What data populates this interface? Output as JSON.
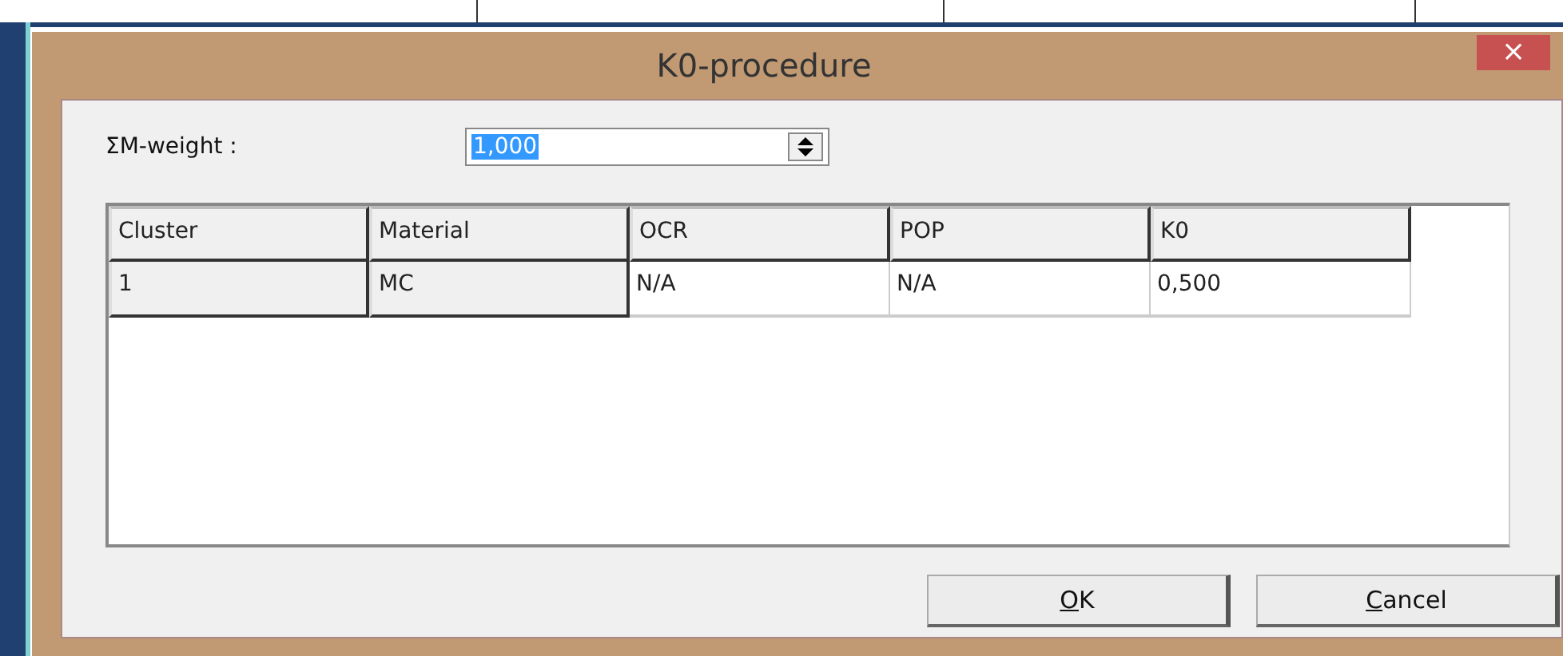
{
  "window": {
    "title": "K0-procedure",
    "close": "×"
  },
  "weight": {
    "label": "ΣM-weight :",
    "value": "1,000",
    "text_selected": true
  },
  "table": {
    "columns": [
      {
        "label": "Cluster",
        "fixed": true
      },
      {
        "label": "Material",
        "fixed": true
      },
      {
        "label": "OCR",
        "fixed": false
      },
      {
        "label": "POP",
        "fixed": false
      },
      {
        "label": "K0",
        "fixed": false
      }
    ],
    "rows": [
      [
        "1",
        "MC",
        "N/A",
        "N/A",
        "0,500"
      ]
    ]
  },
  "buttons": [
    {
      "label": "OK",
      "mnemonic_underlined": true
    },
    {
      "label": "Cancel",
      "mnemonic_underlined": true
    }
  ]
}
